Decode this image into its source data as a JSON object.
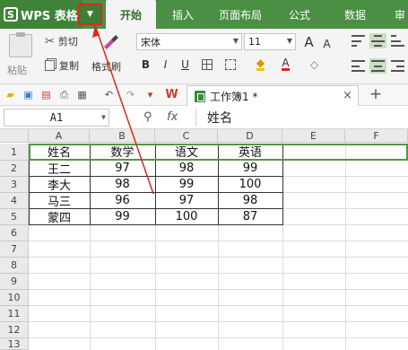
{
  "app": {
    "logo_mark": "S",
    "name": "WPS 表格",
    "dropdown_glyph": "▼",
    "accent": "#4a8f43",
    "highlight_color": "#d82a20"
  },
  "menu_tabs": [
    "开始",
    "插入",
    "页面布局",
    "公式",
    "数据",
    "审"
  ],
  "ribbon": {
    "cut": "剪切",
    "paste": "粘贴",
    "copy": "复制",
    "format_painter": "格式刷",
    "font_name": "宋体",
    "font_size": "11",
    "bold": "B",
    "italic": "I",
    "underline": "U",
    "grow_font": "A",
    "shrink_font": "A"
  },
  "quick_access": {
    "doc_tab_title": "工作簿1 *",
    "close_glyph": "×",
    "new_tab_glyph": "+"
  },
  "formula_bar": {
    "cell_ref": "A1",
    "fx": "fx",
    "value": "姓名"
  },
  "sheet": {
    "columns": [
      "A",
      "B",
      "C",
      "D",
      "E",
      "F"
    ],
    "rows": [
      "1",
      "2",
      "3",
      "4",
      "5",
      "6",
      "7",
      "8",
      "9",
      "10",
      "11",
      "12",
      "13"
    ],
    "header": [
      "姓名",
      "数学",
      "语文",
      "英语"
    ],
    "data": [
      [
        "王二",
        "97",
        "98",
        "99"
      ],
      [
        "李大",
        "98",
        "99",
        "100"
      ],
      [
        "马三",
        "96",
        "97",
        "98"
      ],
      [
        "蒙四",
        "99",
        "100",
        "87"
      ]
    ]
  }
}
